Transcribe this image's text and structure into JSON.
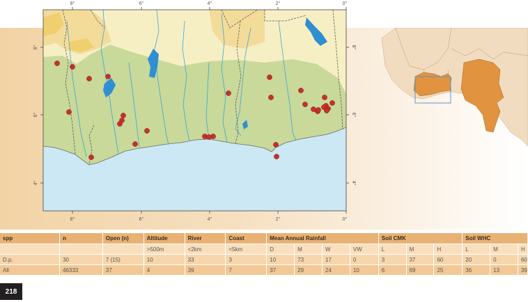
{
  "map": {
    "top_ticks": [
      "8°",
      "6°",
      "4°",
      "2°",
      "0°"
    ],
    "bottom_ticks": [
      "8°",
      "6°",
      "4°",
      "2°",
      "0°"
    ],
    "left_ticks": [
      "8°",
      "6°",
      "4°"
    ],
    "right_ticks": [
      "8°",
      "6°",
      "4°"
    ],
    "colors": {
      "ocean": "#cbe8f4",
      "lowland": "#c8d99a",
      "savanna": "#f7efc4",
      "highland": "#f3dc9a",
      "plateau": "#f0cf6e",
      "river": "#3aa5d8",
      "lake": "#2f8fd0",
      "border": "#5a5a5a",
      "record_point": "#c8302c"
    },
    "record_count": 30
  },
  "inset": {
    "colors": {
      "land": "#f1dcc0",
      "highlight": "#e2933f",
      "frame": "#5f97c4"
    }
  },
  "table": {
    "header": [
      "spp",
      "n",
      "Open (n)",
      "Altitude",
      "River",
      "Coast",
      "Mean Annual Rainfall",
      "Soil  CMK",
      "Soil WHC"
    ],
    "subheader": [
      "",
      "",
      "",
      ">500m",
      "<2km",
      "<5km",
      "D",
      "M",
      "W",
      "VW",
      "L",
      "M",
      "H",
      "L",
      "M",
      "H"
    ],
    "rows": [
      [
        "D.p.",
        "30",
        "7 (15)",
        "10",
        "33",
        "3",
        "10",
        "73",
        "17",
        "0",
        "3",
        "37",
        "60",
        "20",
        "0",
        "60"
      ],
      [
        "All",
        "46333",
        "37",
        "4",
        "39",
        "7",
        "37",
        "29",
        "24",
        "10",
        "6",
        "69",
        "25",
        "36",
        "13",
        "39"
      ]
    ]
  },
  "page_number": "218"
}
